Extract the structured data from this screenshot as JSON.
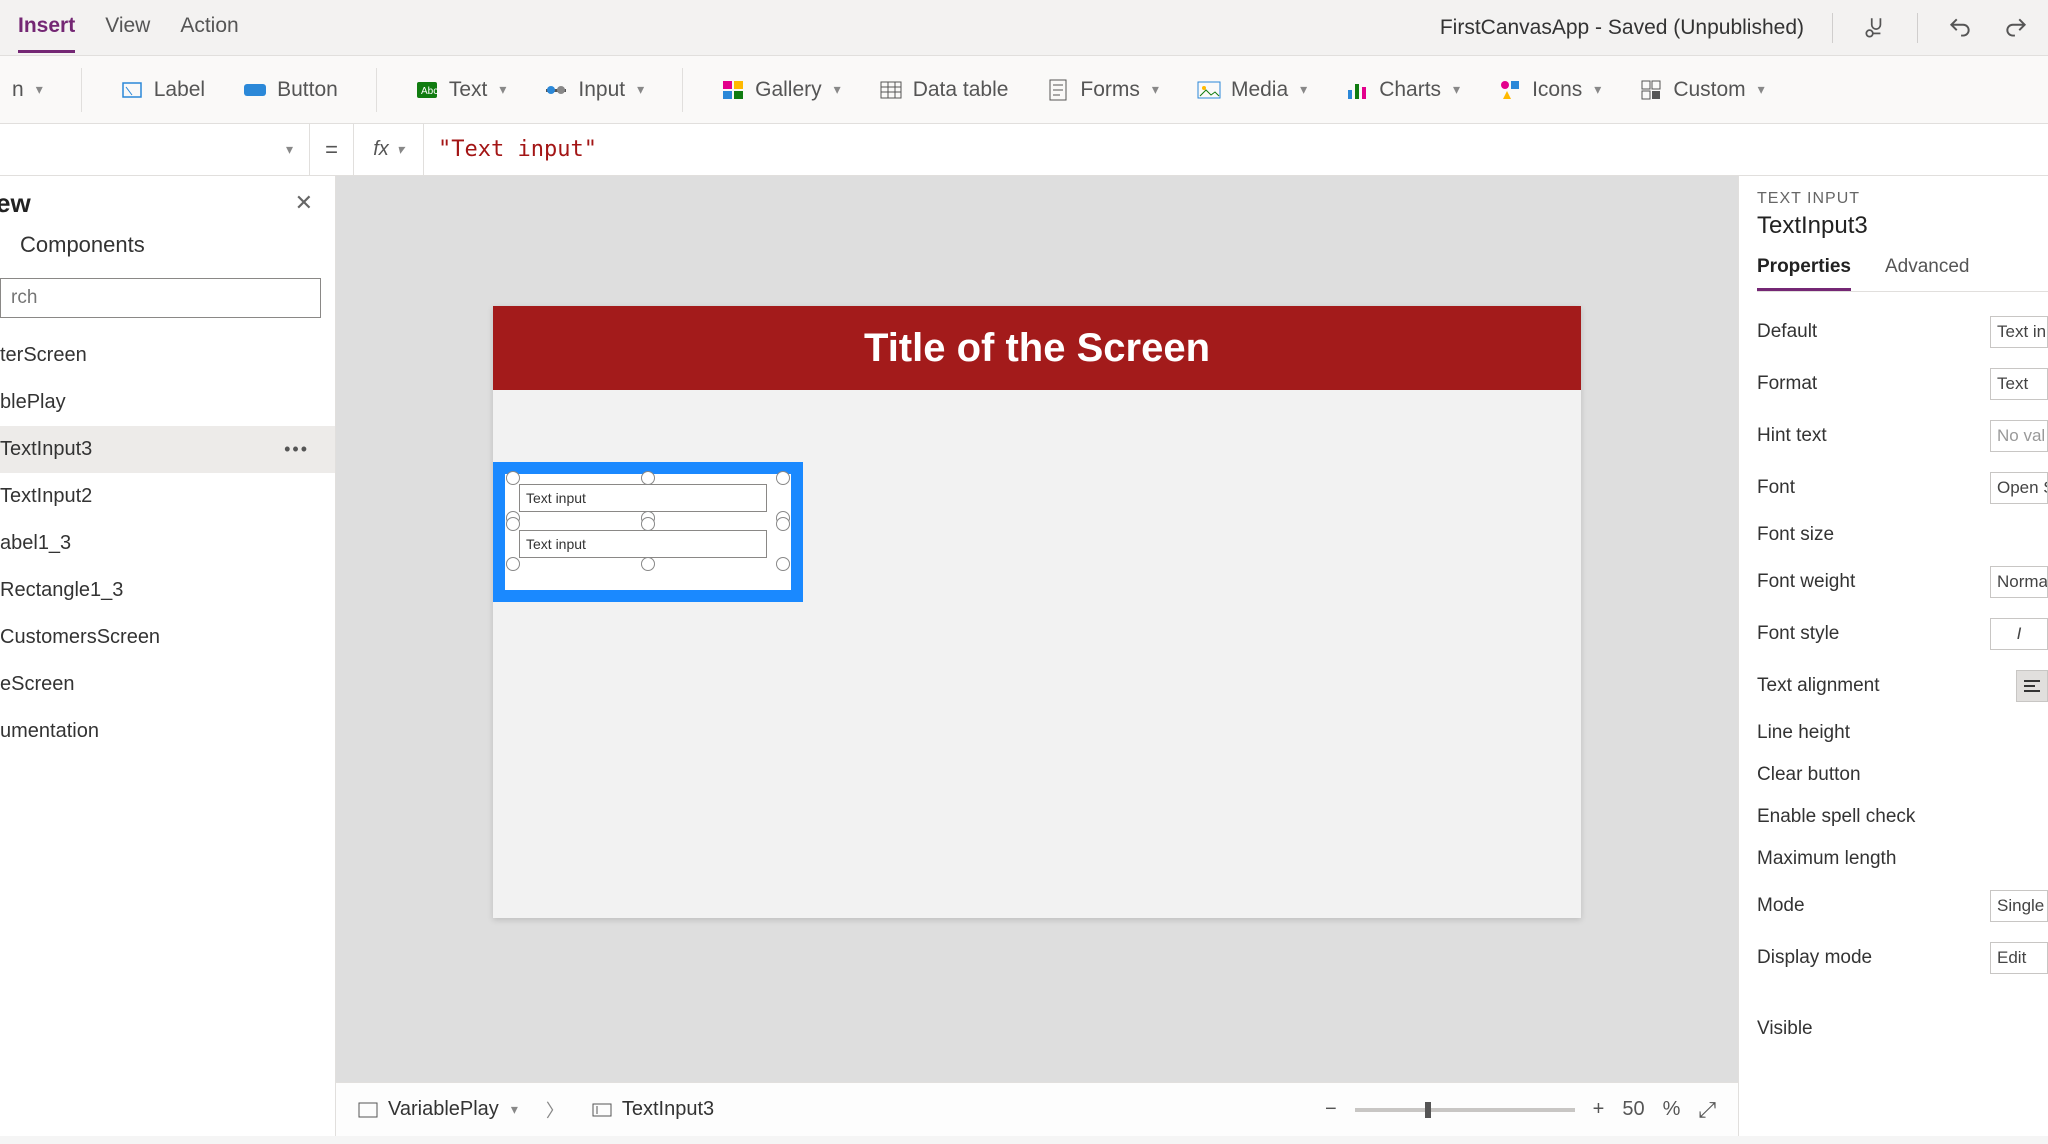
{
  "menubar": {
    "items": [
      "Insert",
      "View",
      "Action"
    ],
    "active_index": 0,
    "app_title": "FirstCanvasApp - Saved (Unpublished)"
  },
  "ribbon": {
    "new_dropdown": "n",
    "items": [
      {
        "label": "Label",
        "icon": "label-icon"
      },
      {
        "label": "Button",
        "icon": "button-icon"
      },
      {
        "label": "Text",
        "icon": "text-icon",
        "dropdown": true
      },
      {
        "label": "Input",
        "icon": "input-icon",
        "dropdown": true
      },
      {
        "label": "Gallery",
        "icon": "gallery-icon",
        "dropdown": true
      },
      {
        "label": "Data table",
        "icon": "datatable-icon"
      },
      {
        "label": "Forms",
        "icon": "forms-icon",
        "dropdown": true
      },
      {
        "label": "Media",
        "icon": "media-icon",
        "dropdown": true
      },
      {
        "label": "Charts",
        "icon": "charts-icon",
        "dropdown": true
      },
      {
        "label": "Icons",
        "icon": "icons-icon",
        "dropdown": true
      },
      {
        "label": "Custom",
        "icon": "custom-icon",
        "dropdown": true
      }
    ]
  },
  "formula": {
    "eq": "=",
    "fx": "fx",
    "value": "\"Text input\""
  },
  "tree": {
    "title": "ew",
    "tab": "Components",
    "search_placeholder": "rch",
    "items": [
      "terScreen",
      "blePlay",
      "TextInput3",
      "TextInput2",
      "abel1_3",
      "Rectangle1_3",
      "CustomersScreen",
      "eScreen",
      "umentation"
    ],
    "selected_index": 2
  },
  "canvas": {
    "screen_title": "Title of the Screen",
    "ctrl1_text": "Text input",
    "ctrl2_text": "Text input"
  },
  "breadcrumb": {
    "screen": "VariablePlay",
    "control": "TextInput3"
  },
  "zoom": {
    "percent": "50",
    "unit": "%"
  },
  "props": {
    "category": "TEXT INPUT",
    "name": "TextInput3",
    "tabs": [
      "Properties",
      "Advanced"
    ],
    "rows": {
      "default": {
        "label": "Default",
        "value": "Text in"
      },
      "format": {
        "label": "Format",
        "value": "Text"
      },
      "hint": {
        "label": "Hint text",
        "value": "No val"
      },
      "font": {
        "label": "Font",
        "value": "Open S"
      },
      "fontsize": {
        "label": "Font size",
        "value": ""
      },
      "fontweight": {
        "label": "Font weight",
        "value": "Norma"
      },
      "fontstyle": {
        "label": "Font style",
        "value": "I"
      },
      "textalign": {
        "label": "Text alignment",
        "value": ""
      },
      "lineheight": {
        "label": "Line height",
        "value": ""
      },
      "clearbtn": {
        "label": "Clear button",
        "value": ""
      },
      "spell": {
        "label": "Enable spell check",
        "value": ""
      },
      "maxlen": {
        "label": "Maximum length",
        "value": ""
      },
      "mode": {
        "label": "Mode",
        "value": "Single"
      },
      "dispmode": {
        "label": "Display mode",
        "value": "Edit"
      },
      "visible": {
        "label": "Visible",
        "value": ""
      }
    }
  }
}
